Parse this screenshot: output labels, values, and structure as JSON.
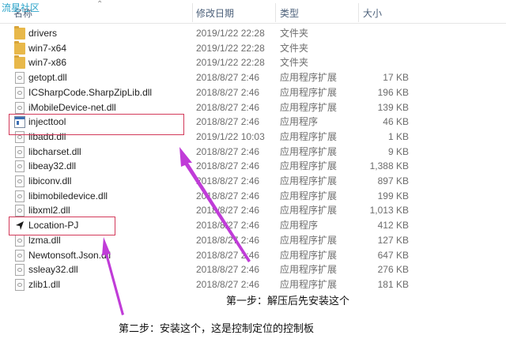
{
  "watermark": "流星社区",
  "columns": {
    "name": "名称",
    "date": "修改日期",
    "type": "类型",
    "size": "大小"
  },
  "files": [
    {
      "name": "drivers",
      "date": "2019/1/22 22:28",
      "type": "文件夹",
      "size": "",
      "icon": "folder-icon"
    },
    {
      "name": "win7-x64",
      "date": "2019/1/22 22:28",
      "type": "文件夹",
      "size": "",
      "icon": "folder-icon"
    },
    {
      "name": "win7-x86",
      "date": "2019/1/22 22:28",
      "type": "文件夹",
      "size": "",
      "icon": "folder-icon"
    },
    {
      "name": "getopt.dll",
      "date": "2018/8/27 2:46",
      "type": "应用程序扩展",
      "size": "17 KB",
      "icon": "dll-icon"
    },
    {
      "name": "ICSharpCode.SharpZipLib.dll",
      "date": "2018/8/27 2:46",
      "type": "应用程序扩展",
      "size": "196 KB",
      "icon": "dll-icon"
    },
    {
      "name": "iMobileDevice-net.dll",
      "date": "2018/8/27 2:46",
      "type": "应用程序扩展",
      "size": "139 KB",
      "icon": "dll-icon"
    },
    {
      "name": "injecttool",
      "date": "2018/8/27 2:46",
      "type": "应用程序",
      "size": "46 KB",
      "icon": "exe-icon"
    },
    {
      "name": "libadd.dll",
      "date": "2019/1/22 10:03",
      "type": "应用程序扩展",
      "size": "1 KB",
      "icon": "dll-icon"
    },
    {
      "name": "libcharset.dll",
      "date": "2018/8/27 2:46",
      "type": "应用程序扩展",
      "size": "9 KB",
      "icon": "dll-icon"
    },
    {
      "name": "libeay32.dll",
      "date": "2018/8/27 2:46",
      "type": "应用程序扩展",
      "size": "1,388 KB",
      "icon": "dll-icon"
    },
    {
      "name": "libiconv.dll",
      "date": "2018/8/27 2:46",
      "type": "应用程序扩展",
      "size": "897 KB",
      "icon": "dll-icon"
    },
    {
      "name": "libimobiledevice.dll",
      "date": "2018/8/27 2:46",
      "type": "应用程序扩展",
      "size": "199 KB",
      "icon": "dll-icon"
    },
    {
      "name": "libxml2.dll",
      "date": "2018/8/27 2:46",
      "type": "应用程序扩展",
      "size": "1,013 KB",
      "icon": "dll-icon"
    },
    {
      "name": "Location-PJ",
      "date": "2018/8/27 2:46",
      "type": "应用程序",
      "size": "412 KB",
      "icon": "location-arrow-icon"
    },
    {
      "name": "lzma.dll",
      "date": "2018/8/27 2:46",
      "type": "应用程序扩展",
      "size": "127 KB",
      "icon": "dll-icon"
    },
    {
      "name": "Newtonsoft.Json.dll",
      "date": "2018/8/27 2:46",
      "type": "应用程序扩展",
      "size": "647 KB",
      "icon": "dll-icon"
    },
    {
      "name": "ssleay32.dll",
      "date": "2018/8/27 2:46",
      "type": "应用程序扩展",
      "size": "276 KB",
      "icon": "dll-icon"
    },
    {
      "name": "zlib1.dll",
      "date": "2018/8/27 2:46",
      "type": "应用程序扩展",
      "size": "181 KB",
      "icon": "dll-icon"
    }
  ],
  "annotations": {
    "step1": "第一步：解压后先安装这个",
    "step2": "第二步：安装这个，这是控制定位的控制板"
  },
  "colors": {
    "highlight": "#d33a5a",
    "pointer": "#c03cd8",
    "watermark": "#2aa3c9"
  }
}
